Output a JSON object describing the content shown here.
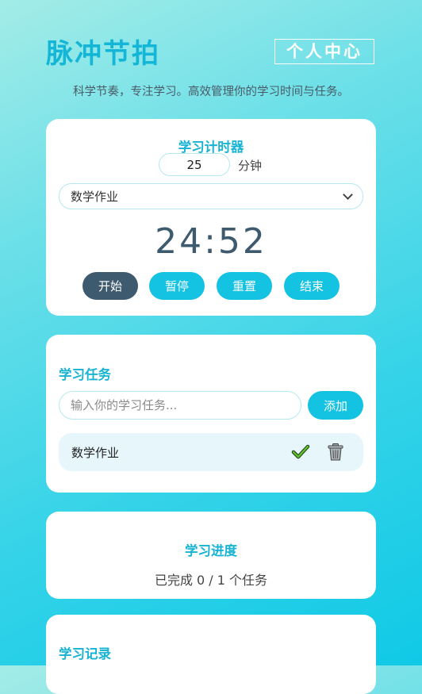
{
  "header": {
    "title": "脉冲节拍",
    "profile_label": "个人中心",
    "subtitle": "科学节奏，专注学习。高效管理你的学习时间与任务。"
  },
  "timer": {
    "heading": "学习计时器",
    "minutes_value": "25",
    "minutes_unit": "分钟",
    "selected_task": "数学作业",
    "display": "24:52",
    "buttons": {
      "start": "开始",
      "pause": "暂停",
      "reset": "重置",
      "end": "结束"
    }
  },
  "tasks": {
    "heading": "学习任务",
    "input_placeholder": "输入你的学习任务...",
    "add_label": "添加",
    "items": [
      {
        "label": "数学作业",
        "complete_icon": "checkmark-icon",
        "delete_icon": "trash-icon"
      }
    ]
  },
  "progress": {
    "heading": "学习进度",
    "text": "已完成 0 / 1 个任务"
  },
  "records": {
    "heading": "学习记录"
  },
  "colors": {
    "accent": "#14c2e2",
    "heading": "#18b3d3",
    "dark_button": "#3e5a6e",
    "timer_text": "#3e5a6e"
  }
}
